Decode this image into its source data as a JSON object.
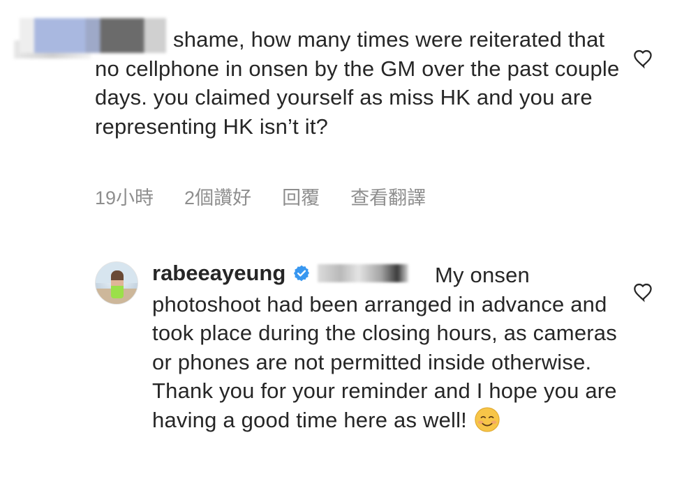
{
  "comment_1": {
    "text": "shame, how many times were reiterated that no cellphone in onsen by the GM over the past couple days. you claimed yourself as miss HK and you are representing HK isn’t it?",
    "meta": {
      "time": "19小時",
      "likes": "2個讚好",
      "reply": "回覆",
      "translate": "查看翻譯"
    },
    "icons": {
      "like": "heart-outline-icon"
    }
  },
  "comment_2": {
    "username": "rabeeayeung",
    "verified_icon": "verified-badge-icon",
    "text": "My onsen photoshoot had been arranged in advance and took place during the closing hours, as cameras or phones are not permitted inside otherwise. Thank you for your reminder and I hope you are having a good time here as well!",
    "emoji": "☺️",
    "icons": {
      "like": "heart-outline-icon"
    }
  },
  "colors": {
    "text": "#262626",
    "meta": "#8e8e8e",
    "verified": "#3897f0",
    "emoji": "#f7c548"
  }
}
